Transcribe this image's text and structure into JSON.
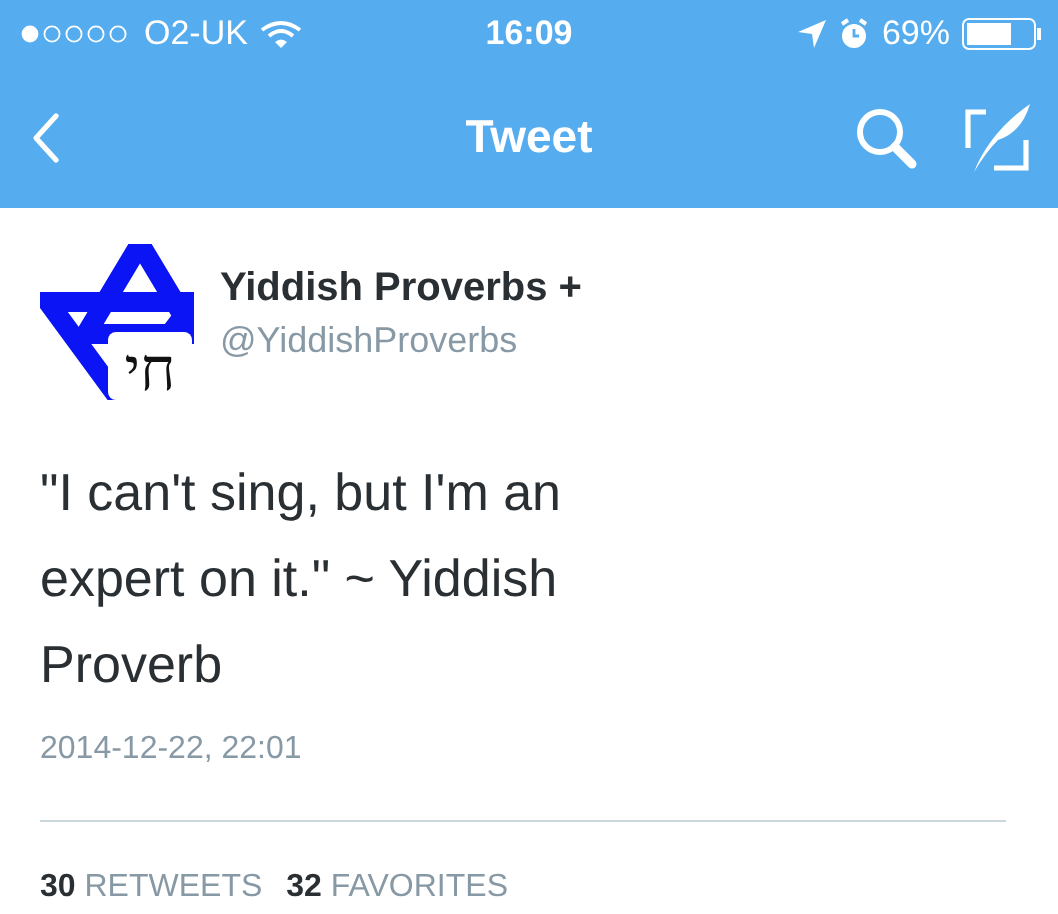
{
  "status_bar": {
    "carrier": "O2-UK",
    "time": "16:09",
    "battery": "69%"
  },
  "nav": {
    "title": "Tweet"
  },
  "tweet": {
    "avatar": {
      "text": "חי"
    },
    "name": "Yiddish Proverbs +",
    "handle": "@YiddishProverbs",
    "text": "\"I can't sing, but I'm an expert on it.\" ~ Yiddish Proverb",
    "date": "2014-12-22, 22:01"
  },
  "stats": [
    {
      "count": "30",
      "label": "RETWEETS"
    },
    {
      "count": "32",
      "label": "FAVORITES"
    }
  ]
}
